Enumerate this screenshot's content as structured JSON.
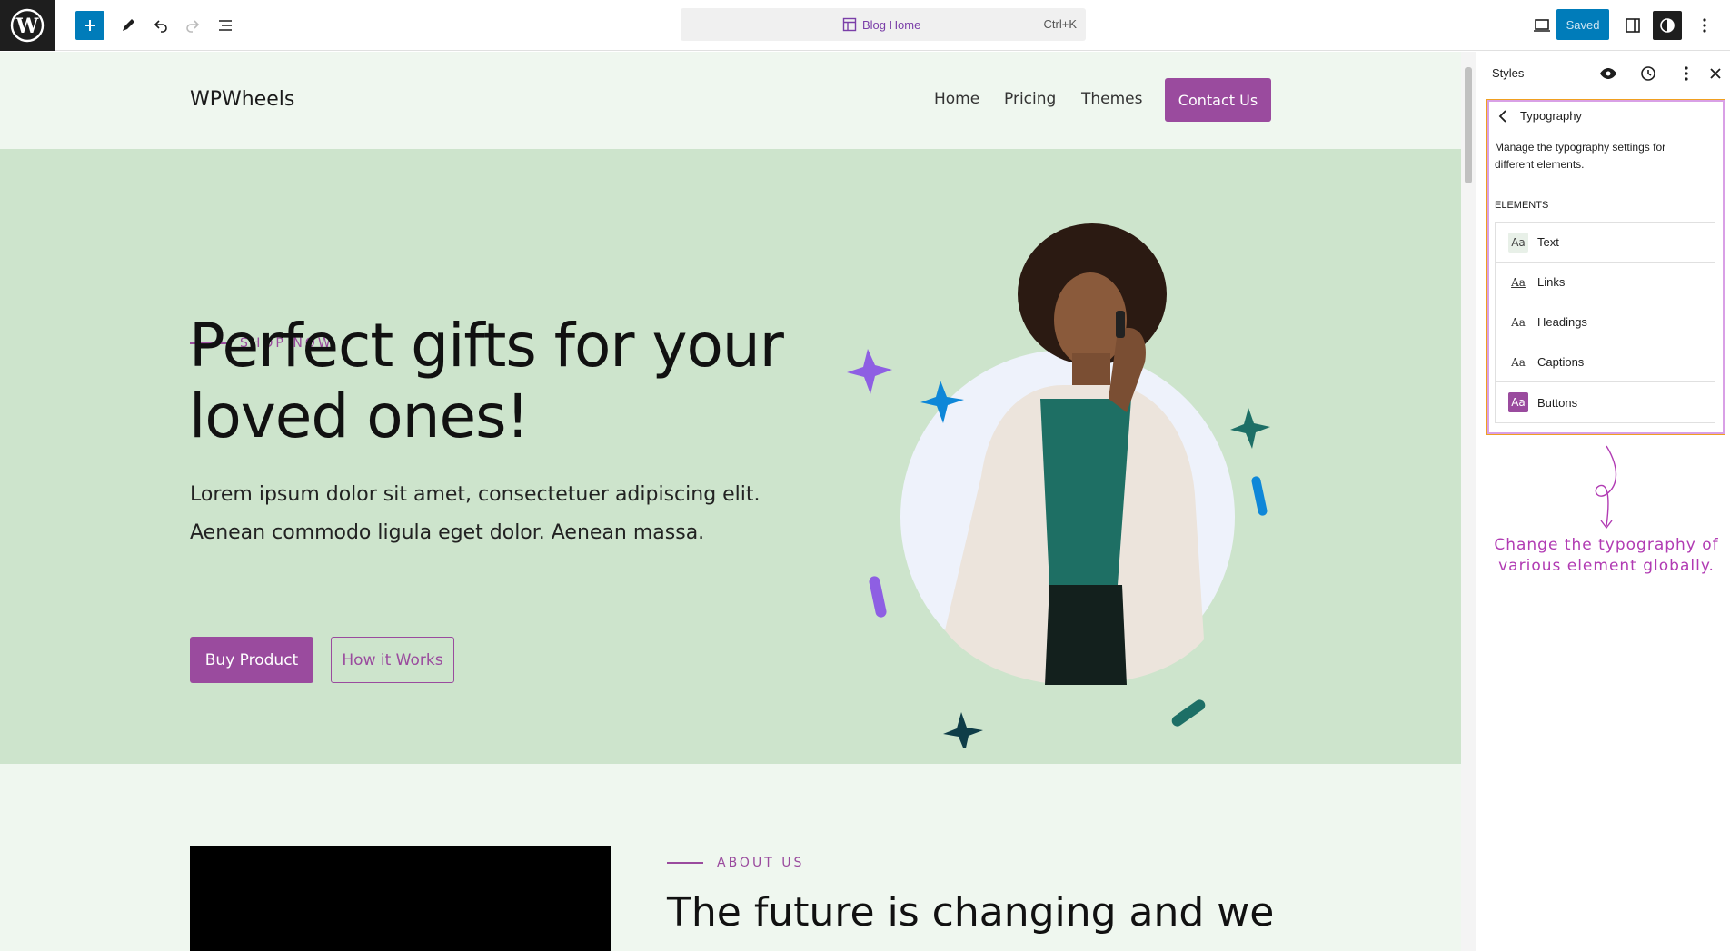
{
  "toolbar": {
    "document_title": "Blog Home",
    "shortcut": "Ctrl+K",
    "saved_label": "Saved"
  },
  "site": {
    "title": "WPWheels",
    "nav": [
      "Home",
      "Pricing",
      "Themes"
    ],
    "contact_label": "Contact Us"
  },
  "hero": {
    "eyebrow": "SHOP NOW",
    "heading": "Perfect gifts for your loved ones!",
    "text": "Lorem ipsum dolor sit amet, consectetuer adipiscing elit. Aenean commodo ligula eget dolor. Aenean massa.",
    "buy_label": "Buy Product",
    "how_label": "How it Works"
  },
  "about": {
    "eyebrow": "ABOUT US",
    "heading": "The future is changing and we"
  },
  "sidebar": {
    "title": "Styles",
    "panel_title": "Typography",
    "description": "Manage the typography settings for different elements.",
    "elements_label": "ELEMENTS",
    "elements": [
      {
        "icon": "Aa",
        "label": "Text"
      },
      {
        "icon": "Aa",
        "label": "Links"
      },
      {
        "icon": "Aa",
        "label": "Headings"
      },
      {
        "icon": "Aa",
        "label": "Captions"
      },
      {
        "icon": "Aa",
        "label": "Buttons"
      }
    ],
    "annotation": "Change the typography of various element globally."
  },
  "colors": {
    "accent": "#9a4b9e",
    "wp_blue": "#007cba",
    "hero_bg": "#cde4cc",
    "page_bg": "#eff7ef",
    "annotation": "#b13bb3"
  }
}
